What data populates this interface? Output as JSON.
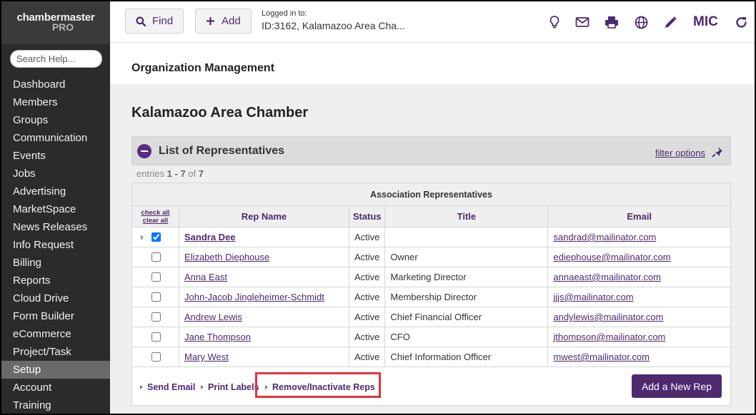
{
  "brand": {
    "line1": "chambermaster",
    "line2": "PRO"
  },
  "sidebar": {
    "search_placeholder": "Search Help...",
    "items": [
      "Dashboard",
      "Members",
      "Groups",
      "Communication",
      "Events",
      "Jobs",
      "Advertising",
      "MarketSpace",
      "News Releases",
      "Info Request",
      "Billing",
      "Reports",
      "Cloud Drive",
      "Form Builder",
      "eCommerce",
      "Project/Task",
      "Setup",
      "Account",
      "Training"
    ],
    "active": "Setup"
  },
  "topbar": {
    "find_label": "Find",
    "add_label": "Add",
    "logged_in_label": "Logged in to:",
    "logged_in_value": "ID:3162, Kalamazoo Area Cha...",
    "user_initials": "MIC"
  },
  "page": {
    "breadcrumb": "Organization Management",
    "org_name": "Kalamazoo Area Chamber"
  },
  "panel": {
    "title": "List of Representatives",
    "filter_label": "filter options",
    "entries_prefix": "entries",
    "entries_range": "1 - 7",
    "entries_of": "of",
    "entries_total": "7",
    "table_caption": "Association Representatives",
    "check_all": "check all",
    "clear_all": "clear all",
    "columns": [
      "Rep Name",
      "Status",
      "Title",
      "Email"
    ],
    "rows": [
      {
        "name": "Sandra Dee",
        "status": "Active",
        "title": "",
        "email": "sandrad@mailinator.com",
        "checked": true
      },
      {
        "name": "Elizabeth Diephouse",
        "status": "Active",
        "title": "Owner",
        "email": "ediephouse@mailinator.com",
        "checked": false
      },
      {
        "name": "Anna East",
        "status": "Active",
        "title": "Marketing Director",
        "email": "annaeast@mailinator.com",
        "checked": false
      },
      {
        "name": "John-Jacob Jingleheimer-Schmidt",
        "status": "Active",
        "title": "Membership Director",
        "email": "jjjs@mailinator.com",
        "checked": false
      },
      {
        "name": "Andrew Lewis",
        "status": "Active",
        "title": "Chief Financial Officer",
        "email": "andylewis@mailinator.com",
        "checked": false
      },
      {
        "name": "Jane Thompson",
        "status": "Active",
        "title": "CFO",
        "email": "jthompson@mailinator.com",
        "checked": false
      },
      {
        "name": "Mary West",
        "status": "Active",
        "title": "Chief Information Officer",
        "email": "mwest@mailinator.com",
        "checked": false
      }
    ],
    "footer": {
      "send_email": "Send Email",
      "print_labels": "Print Labels",
      "remove_reps": "Remove/Inactivate Reps",
      "add_rep": "Add a New Rep"
    }
  },
  "colors": {
    "accent": "#4d2a6e",
    "highlight": "#e2343b",
    "sidebar": "#2b2b2b"
  },
  "icons": [
    "search-icon",
    "plus-icon",
    "lightbulb-icon",
    "mail-icon",
    "printer-icon",
    "globe-icon",
    "pencil-icon",
    "refresh-icon",
    "pin-icon",
    "collapse-icon"
  ]
}
